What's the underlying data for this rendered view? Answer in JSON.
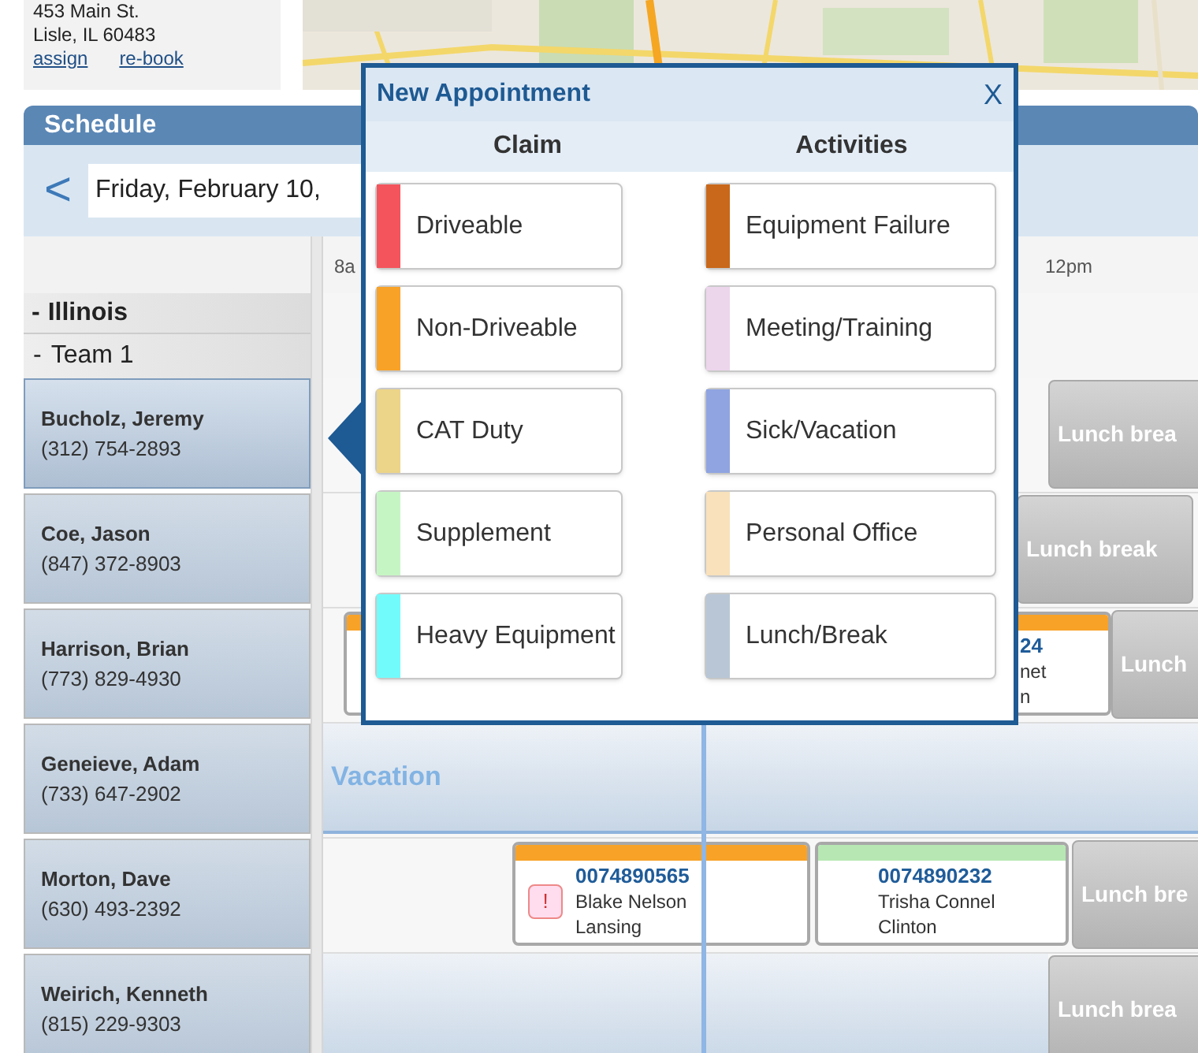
{
  "address": {
    "lines": [
      "453 Main St.",
      "Lisle, IL 60483"
    ],
    "links": [
      "assign",
      "re-book"
    ]
  },
  "schedule": {
    "title": "Schedule",
    "prev": "<",
    "date": "Friday, February 10,",
    "time_labels": [
      "8a",
      "12pm"
    ],
    "groups": [
      {
        "toggle": "-",
        "label": "Illinois",
        "children": [
          {
            "toggle": "-",
            "label": "Team 1"
          }
        ]
      }
    ],
    "adjusters": [
      {
        "name": "Bucholz, Jeremy",
        "phone": "(312) 754-2893",
        "selected": true,
        "events": [
          {
            "kind": "lunch",
            "label": "Lunch brea"
          }
        ]
      },
      {
        "name": "Coe, Jason",
        "phone": "(847) 372-8903",
        "selected": false,
        "events": [
          {
            "kind": "lunch",
            "label": "Lunch break"
          }
        ]
      },
      {
        "name": "Harrison, Brian",
        "phone": "(773) 829-4930",
        "selected": false,
        "events": [
          {
            "kind": "appointment",
            "color": "#f8a227",
            "number": "24",
            "person": "net",
            "city": "n"
          },
          {
            "kind": "lunch",
            "label": "Lunch"
          }
        ]
      },
      {
        "name": "Geneieve, Adam",
        "phone": "(733) 647-2902",
        "selected": false,
        "events": [
          {
            "kind": "vacation",
            "label": "Vacation"
          }
        ]
      },
      {
        "name": "Morton, Dave",
        "phone": "(630) 493-2392",
        "selected": false,
        "events": [
          {
            "kind": "appointment",
            "color": "#f8a227",
            "alert": "!",
            "number": "0074890565",
            "person": "Blake Nelson",
            "city": "Lansing"
          },
          {
            "kind": "appointment",
            "color": "#b7e8b3",
            "number": "0074890232",
            "person": "Trisha Connel",
            "city": "Clinton"
          },
          {
            "kind": "lunch",
            "label": "Lunch bre"
          }
        ]
      },
      {
        "name": "Weirich, Kenneth",
        "phone": "(815) 229-9303",
        "selected": false,
        "events": [
          {
            "kind": "block"
          },
          {
            "kind": "lunch",
            "label": "Lunch brea"
          }
        ]
      }
    ]
  },
  "popup": {
    "title": "New Appointment",
    "close": "X",
    "columns": [
      {
        "heading": "Claim",
        "options": [
          {
            "label": "Driveable",
            "color": "#f4545c"
          },
          {
            "label": "Non-Driveable",
            "color": "#f8a227"
          },
          {
            "label": "CAT Duty",
            "color": "#ecd488"
          },
          {
            "label": "Supplement",
            "color": "#c6f5c4"
          },
          {
            "label": "Heavy Equipment",
            "color": "#72fbfb"
          }
        ]
      },
      {
        "heading": "Activities",
        "options": [
          {
            "label": "Equipment Failure",
            "color": "#c9681a"
          },
          {
            "label": "Meeting/Training",
            "color": "#ecd6ec"
          },
          {
            "label": "Sick/Vacation",
            "color": "#8fa4e0"
          },
          {
            "label": "Personal Office",
            "color": "#f8e1bb"
          },
          {
            "label": "Lunch/Break",
            "color": "#b9c6d6"
          }
        ]
      }
    ]
  }
}
